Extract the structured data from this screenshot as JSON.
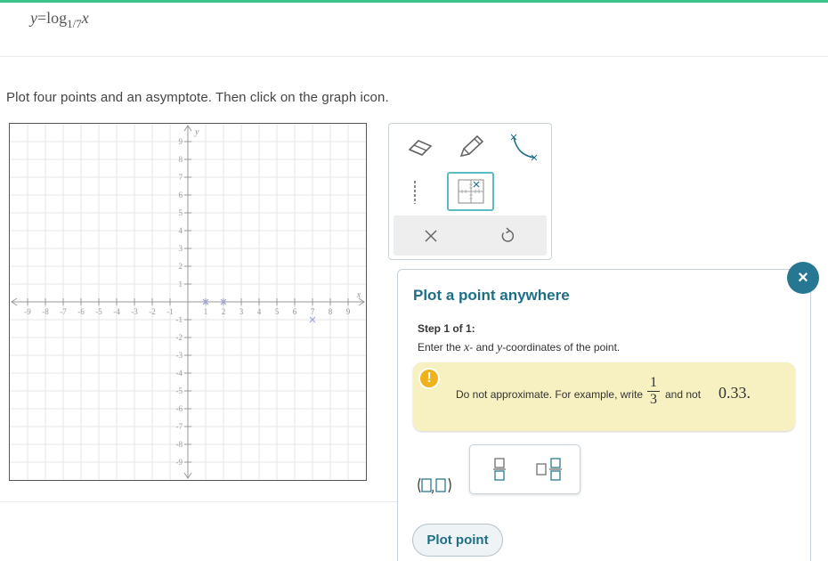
{
  "colors": {
    "accent_bar": "#3cc48d",
    "title": "#1d6f86",
    "hint_background": "#f7f0c0",
    "close_button": "#287792",
    "plotted_point": "#9aa5e0"
  },
  "equation": {
    "lhs": "y",
    "equals": "=",
    "func": "log",
    "base": "1/7",
    "arg": "x"
  },
  "instruction": "Plot four points and an asymptote. Then click on the graph icon.",
  "graph": {
    "x_axis_label": "x",
    "y_axis_label": "y",
    "x_range": [
      -10,
      10
    ],
    "y_range": [
      -10,
      10
    ],
    "x_ticks": [
      "-9",
      "-8",
      "-7",
      "-6",
      "-5",
      "-4",
      "-3",
      "-2",
      "-1",
      "1",
      "2",
      "3",
      "4",
      "5",
      "6",
      "7",
      "8",
      "9"
    ],
    "y_ticks": [
      "9",
      "8",
      "7",
      "6",
      "5",
      "4",
      "3",
      "2",
      "1",
      "-1",
      "-2",
      "-3",
      "-4",
      "-5",
      "-6",
      "-7",
      "-8",
      "-9"
    ],
    "grid": true,
    "plotted_points": [
      {
        "x": 1,
        "y": 0
      },
      {
        "x": 2,
        "y": 0
      },
      {
        "x": 7,
        "y": -1
      }
    ]
  },
  "toolbox": {
    "tools": [
      {
        "name": "eraser-icon"
      },
      {
        "name": "pencil-icon"
      },
      {
        "name": "curve-icon"
      },
      {
        "name": "dashed-line-icon"
      },
      {
        "name": "graph-icon"
      }
    ],
    "actions": [
      {
        "name": "clear-icon"
      },
      {
        "name": "undo-icon"
      }
    ]
  },
  "panel": {
    "title": "Plot a point anywhere",
    "step_label": "Step 1 of 1:",
    "step_text_pre": "Enter the",
    "step_var_x": "x",
    "step_text_mid": "- and",
    "step_var_y": "y",
    "step_text_post": "-coordinates of the point.",
    "hint": {
      "badge": "!",
      "text_before": "Do not approximate. For example, write",
      "fraction_numerator": "1",
      "fraction_denominator": "3",
      "text_after": "and not",
      "number": "0.33."
    },
    "pad_buttons": [
      {
        "name": "fraction-icon"
      },
      {
        "name": "mixed-number-icon"
      }
    ],
    "plot_button": "Plot point",
    "close_button": "×"
  }
}
